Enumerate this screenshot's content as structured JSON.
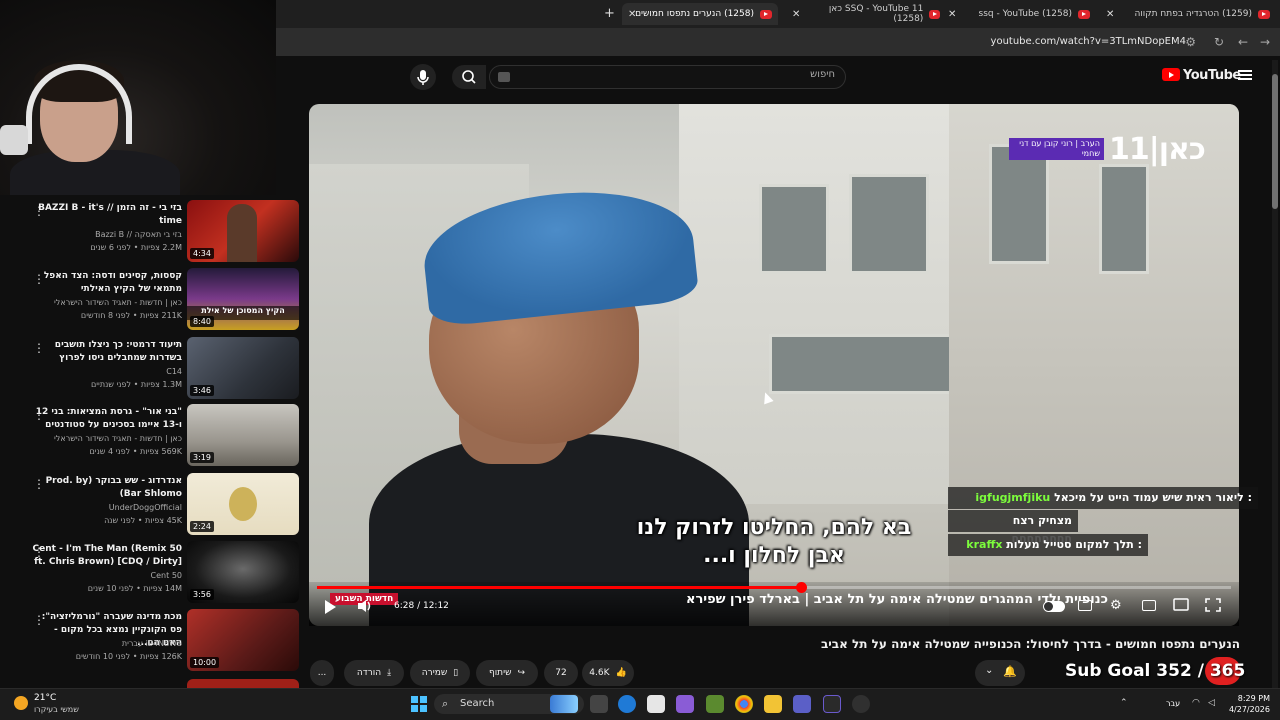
{
  "browser": {
    "tabs": [
      {
        "label": "(1259) הטרגדיה בפתח תקווה"
      },
      {
        "label": "(1258) ssq - YouTube"
      },
      {
        "label": "SSQ - YouTube 11 כאן (1258)"
      },
      {
        "label": "(1258) הנערים נתפסו חמושים",
        "active": true
      }
    ],
    "new_tab": "+",
    "url": "youtube.com/watch?v=3TLmNDopEM4"
  },
  "youtube": {
    "logo_text": "YouTube",
    "search_placeholder": "חיפוש"
  },
  "related": [
    {
      "title": "בזי בי - זה הזמן // BAZZI B - it's time",
      "channel": "בזי בי תאסקה // Bazzi B",
      "meta": "2.2M צפיות • לפני 6 שנים",
      "duration": "4:34"
    },
    {
      "title": "קססות, קסינים ודסה: הצד האפל מתמאי של הקיץ האילתי",
      "channel": "כאן | חדשות - תאגיד השידור הישראלי",
      "meta": "211K צפיות • לפני 8 חודשים",
      "duration": "8:40",
      "thumb_caption": "הקיץ המסוכן של אילת"
    },
    {
      "title": "תיעוד דרמטי: כך ניצלו תושבים בשדרות שמחבלים ניסו לפרוץ",
      "channel": "C14",
      "meta": "1.3M צפיות • לפני שנתיים",
      "duration": "3:46"
    },
    {
      "title": "\"בני אור\" - גרסת המציאות: בני 12 ו-13 איימו בסכינים על סטודנטים",
      "channel": "כאן | חדשות - תאגיד השידור הישראלי",
      "meta": "569K צפיות • לפני 4 שנים",
      "duration": "3:19"
    },
    {
      "title": "אנדרדוג - שש בבוקר (Prod. by Bar Shlomo)",
      "channel": "UnderDoggOfficial",
      "meta": "45K צפיות • לפני שנה",
      "duration": "2:24"
    },
    {
      "title": "50 Cent - I'm The Man (Remix ft. Chris Brown) [CDQ / Dirty]",
      "channel": "50 Cent",
      "meta": "14M צפיות • לפני 10 שנים",
      "duration": "3:56"
    },
    {
      "title": "מכת מדינה שעברה \"נורמליזציה\": פס הקונקיין נמצא בכל מקום - האם הם...",
      "channel": "i24NEWS עברית",
      "meta": "126K צפיות • לפני 10 חודשים",
      "duration": "10:00"
    }
  ],
  "player": {
    "channel_logo": "כאן|11",
    "badge": "הערב | רוני קובן עם דני שחמי",
    "subtitle_line1": "בא להם, החליטו לזרוק לנו",
    "subtitle_line2": "אבן לחלון ו...",
    "breaking_label": "חדשות השבוע",
    "ticker": "כנופיית ילדי המהגרים שמטילה אימה על תל אביב",
    "ticker_name": "בארלד פירן שפירא",
    "time_current": "6:28",
    "time_total": "12:12",
    "time_display": "6:28 / 12:12",
    "progress": 0.53
  },
  "chat": [
    {
      "user": "igfugjmfjiku",
      "message": ": ליאור ראית שיש עמוד הייט על מיכאל"
    },
    {
      "user": "",
      "message": "מצחיק רצח חחחחחחחח"
    },
    {
      "user": "kraffx",
      "message": ": תלך למקום סטייל מעלות"
    }
  ],
  "below": {
    "title": "הנערים נתפסו חמושים - בדרך לחיסול: הכנופייה שמטילה אימה על תל אביב",
    "likes": "4.6K",
    "comments": "72",
    "share": "שיתוף",
    "save": "שמירה",
    "download": "הורדה",
    "more": "..."
  },
  "overlay": {
    "sub_goal": "Sub Goal 352 / 365"
  },
  "taskbar": {
    "temp": "21°C",
    "weather": "שמשי בעיקרו",
    "search": "Search",
    "lang": "עבר",
    "time": "8:29 PM",
    "date": "4/27/2026"
  },
  "colors": {
    "accent": "#ff0000",
    "chat_user": "#7cfc3c",
    "kan_badge": "#5b2bb3"
  }
}
